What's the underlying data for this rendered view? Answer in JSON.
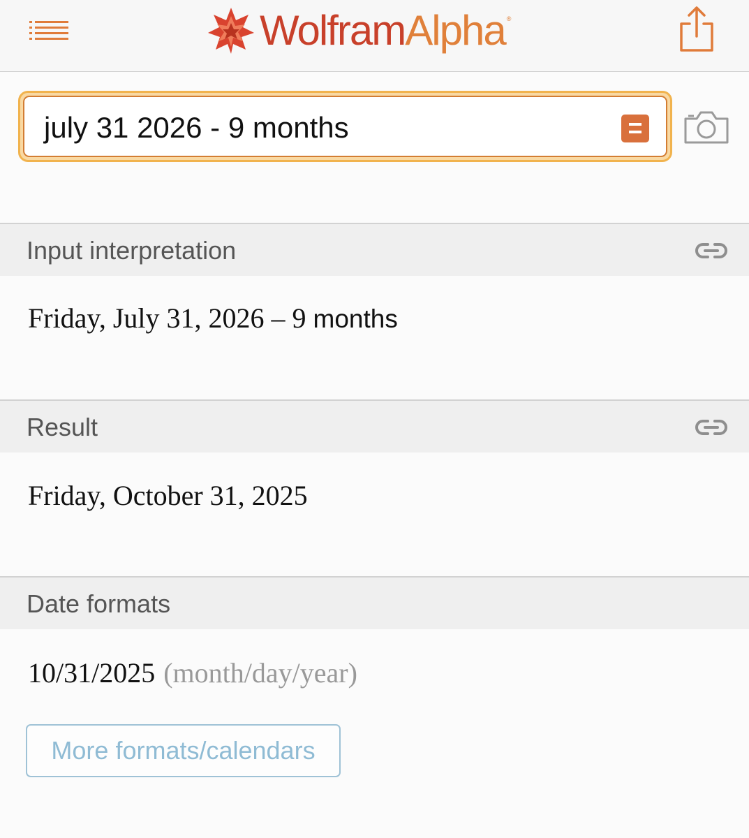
{
  "header": {
    "logo_wordmark_1": "Wolfram",
    "logo_wordmark_2": "Alpha",
    "logo_registered": "®",
    "menu_icon": "list-menu-icon",
    "share_icon": "share-icon"
  },
  "search": {
    "query": "july 31 2026 - 9 months",
    "equals_icon": "equals-icon",
    "camera_icon": "camera-icon"
  },
  "pods": [
    {
      "title": "Input interpretation",
      "content_serif": "Friday, July 31, 2026 – 9 ",
      "content_sans": "months",
      "link_icon": "link-icon"
    },
    {
      "title": "Result",
      "content": "Friday, October 31, 2025",
      "link_icon": "link-icon"
    },
    {
      "title": "Date formats",
      "content": "10/31/2025",
      "note": "(month/day/year)",
      "button_label": "More formats/calendars"
    }
  ],
  "colors": {
    "brand_red": "#c8402a",
    "brand_orange": "#e0803a",
    "search_border": "#f1b34e",
    "link_blue": "#8fbbd4"
  }
}
